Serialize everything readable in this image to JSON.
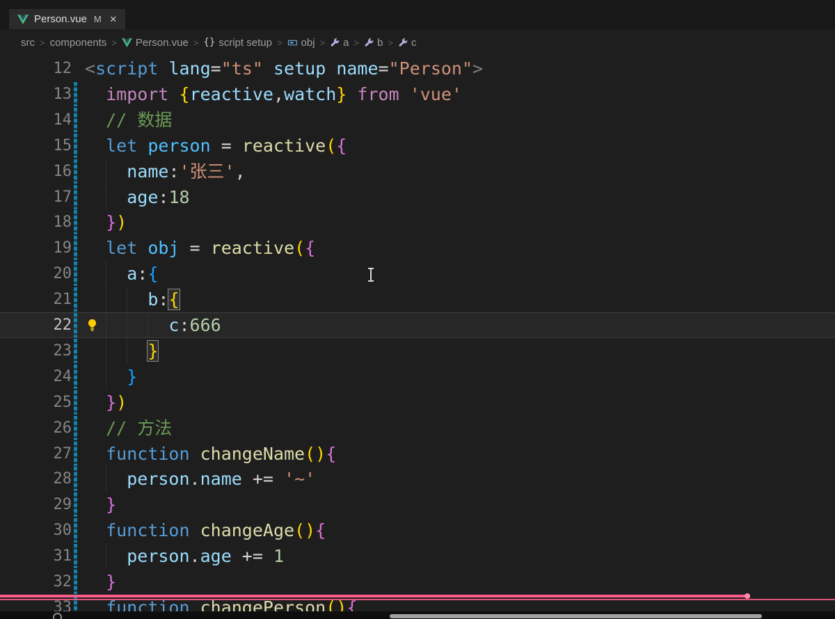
{
  "tab": {
    "title": "Person.vue",
    "git_badge": "M",
    "close_label": "×"
  },
  "breadcrumb": {
    "separator": ">",
    "items": [
      {
        "label": "src",
        "icon": null
      },
      {
        "label": "components",
        "icon": null
      },
      {
        "label": "Person.vue",
        "icon": "vue"
      },
      {
        "label": "script setup",
        "icon": "braces"
      },
      {
        "label": "obj",
        "icon": "symbol-variable"
      },
      {
        "label": "a",
        "icon": "symbol-property"
      },
      {
        "label": "b",
        "icon": "symbol-property"
      },
      {
        "label": "c",
        "icon": "symbol-property"
      }
    ]
  },
  "editor": {
    "current_line": 22,
    "lightbulb_line": 22,
    "lines": [
      {
        "number": 12,
        "modified": false,
        "guides": [],
        "tokens": [
          [
            "tagp",
            "<"
          ],
          [
            "tag",
            "script"
          ],
          [
            "fg",
            " "
          ],
          [
            "attr",
            "lang"
          ],
          [
            "op",
            "="
          ],
          [
            "str",
            "\"ts\""
          ],
          [
            "fg",
            " "
          ],
          [
            "attr",
            "setup"
          ],
          [
            "fg",
            " "
          ],
          [
            "attr",
            "name"
          ],
          [
            "op",
            "="
          ],
          [
            "str",
            "\"Person\""
          ],
          [
            "tagp",
            ">"
          ]
        ]
      },
      {
        "number": 13,
        "modified": true,
        "guides": [],
        "tokens": [
          [
            "fg",
            "  "
          ],
          [
            "ctrl",
            "import"
          ],
          [
            "fg",
            " "
          ],
          [
            "b1",
            "{"
          ],
          [
            "var",
            "reactive"
          ],
          [
            "fg",
            ","
          ],
          [
            "var",
            "watch"
          ],
          [
            "b1",
            "}"
          ],
          [
            "fg",
            " "
          ],
          [
            "ctrl",
            "from"
          ],
          [
            "fg",
            " "
          ],
          [
            "str",
            "'vue'"
          ]
        ]
      },
      {
        "number": 14,
        "modified": true,
        "guides": [],
        "tokens": [
          [
            "fg",
            "  "
          ],
          [
            "cmt",
            "// 数据"
          ]
        ]
      },
      {
        "number": 15,
        "modified": true,
        "guides": [],
        "tokens": [
          [
            "fg",
            "  "
          ],
          [
            "kw",
            "let"
          ],
          [
            "fg",
            " "
          ],
          [
            "decl",
            "person"
          ],
          [
            "fg",
            " = "
          ],
          [
            "fn",
            "reactive"
          ],
          [
            "b1",
            "("
          ],
          [
            "b2",
            "{"
          ]
        ]
      },
      {
        "number": 16,
        "modified": true,
        "guides": [
          2
        ],
        "tokens": [
          [
            "fg",
            "    "
          ],
          [
            "attr",
            "name"
          ],
          [
            "fg",
            ":"
          ],
          [
            "str",
            "'张三'"
          ],
          [
            "fg",
            ","
          ]
        ]
      },
      {
        "number": 17,
        "modified": true,
        "guides": [
          2
        ],
        "tokens": [
          [
            "fg",
            "    "
          ],
          [
            "attr",
            "age"
          ],
          [
            "fg",
            ":"
          ],
          [
            "num",
            "18"
          ]
        ]
      },
      {
        "number": 18,
        "modified": true,
        "guides": [],
        "tokens": [
          [
            "fg",
            "  "
          ],
          [
            "b2",
            "}"
          ],
          [
            "b1",
            ")"
          ]
        ]
      },
      {
        "number": 19,
        "modified": true,
        "guides": [],
        "tokens": [
          [
            "fg",
            "  "
          ],
          [
            "kw",
            "let"
          ],
          [
            "fg",
            " "
          ],
          [
            "decl",
            "obj"
          ],
          [
            "fg",
            " = "
          ],
          [
            "fn",
            "reactive"
          ],
          [
            "b1",
            "("
          ],
          [
            "b2",
            "{"
          ]
        ]
      },
      {
        "number": 20,
        "modified": true,
        "guides": [
          2
        ],
        "tokens": [
          [
            "fg",
            "    "
          ],
          [
            "attr",
            "a"
          ],
          [
            "fg",
            ":"
          ],
          [
            "b3",
            "{"
          ]
        ]
      },
      {
        "number": 21,
        "modified": true,
        "guides": [
          2,
          4
        ],
        "tokens": [
          [
            "fg",
            "      "
          ],
          [
            "attr",
            "b"
          ],
          [
            "fg",
            ":"
          ],
          [
            "b1 match",
            "{"
          ]
        ]
      },
      {
        "number": 22,
        "modified": true,
        "guides": [
          2,
          4,
          6
        ],
        "tokens": [
          [
            "fg",
            "        "
          ],
          [
            "attr",
            "c"
          ],
          [
            "fg",
            ":"
          ],
          [
            "num",
            "666"
          ]
        ]
      },
      {
        "number": 23,
        "modified": true,
        "guides": [
          2,
          4
        ],
        "tokens": [
          [
            "fg",
            "      "
          ],
          [
            "b1 match",
            "}"
          ]
        ]
      },
      {
        "number": 24,
        "modified": true,
        "guides": [
          2
        ],
        "tokens": [
          [
            "fg",
            "    "
          ],
          [
            "b3",
            "}"
          ]
        ]
      },
      {
        "number": 25,
        "modified": true,
        "guides": [],
        "tokens": [
          [
            "fg",
            "  "
          ],
          [
            "b2",
            "}"
          ],
          [
            "b1",
            ")"
          ]
        ]
      },
      {
        "number": 26,
        "modified": true,
        "guides": [],
        "tokens": [
          [
            "fg",
            "  "
          ],
          [
            "cmt",
            "// 方法"
          ]
        ]
      },
      {
        "number": 27,
        "modified": true,
        "guides": [],
        "tokens": [
          [
            "fg",
            "  "
          ],
          [
            "kw",
            "function"
          ],
          [
            "fg",
            " "
          ],
          [
            "fn",
            "changeName"
          ],
          [
            "b1",
            "("
          ],
          [
            "b1",
            ")"
          ],
          [
            "b2",
            "{"
          ]
        ]
      },
      {
        "number": 28,
        "modified": true,
        "guides": [
          2
        ],
        "tokens": [
          [
            "fg",
            "    "
          ],
          [
            "var",
            "person"
          ],
          [
            "fg",
            "."
          ],
          [
            "attr",
            "name"
          ],
          [
            "fg",
            " += "
          ],
          [
            "str",
            "'~'"
          ]
        ]
      },
      {
        "number": 29,
        "modified": true,
        "guides": [],
        "tokens": [
          [
            "fg",
            "  "
          ],
          [
            "b2",
            "}"
          ]
        ]
      },
      {
        "number": 30,
        "modified": true,
        "guides": [],
        "tokens": [
          [
            "fg",
            "  "
          ],
          [
            "kw",
            "function"
          ],
          [
            "fg",
            " "
          ],
          [
            "fn",
            "changeAge"
          ],
          [
            "b1",
            "("
          ],
          [
            "b1",
            ")"
          ],
          [
            "b2",
            "{"
          ]
        ]
      },
      {
        "number": 31,
        "modified": true,
        "guides": [
          2
        ],
        "tokens": [
          [
            "fg",
            "    "
          ],
          [
            "var",
            "person"
          ],
          [
            "fg",
            "."
          ],
          [
            "attr",
            "age"
          ],
          [
            "fg",
            " += "
          ],
          [
            "num",
            "1"
          ]
        ]
      },
      {
        "number": 32,
        "modified": true,
        "guides": [],
        "tokens": [
          [
            "fg",
            "  "
          ],
          [
            "b2",
            "}"
          ]
        ]
      },
      {
        "number": 33,
        "modified": true,
        "guides": [],
        "tokens": [
          [
            "fg",
            "  "
          ],
          [
            "kw",
            "function"
          ],
          [
            "fg",
            " "
          ],
          [
            "fn",
            "changePerson"
          ],
          [
            "b1",
            "("
          ],
          [
            "b1",
            ")"
          ],
          [
            "b2",
            "{"
          ]
        ]
      }
    ]
  },
  "colors": {
    "git_modified": "#1383ae",
    "recording_line": "#ff5c8a",
    "bracket_level1": "#ffd700",
    "bracket_level2": "#da70d6",
    "bracket_level3": "#179fff"
  }
}
